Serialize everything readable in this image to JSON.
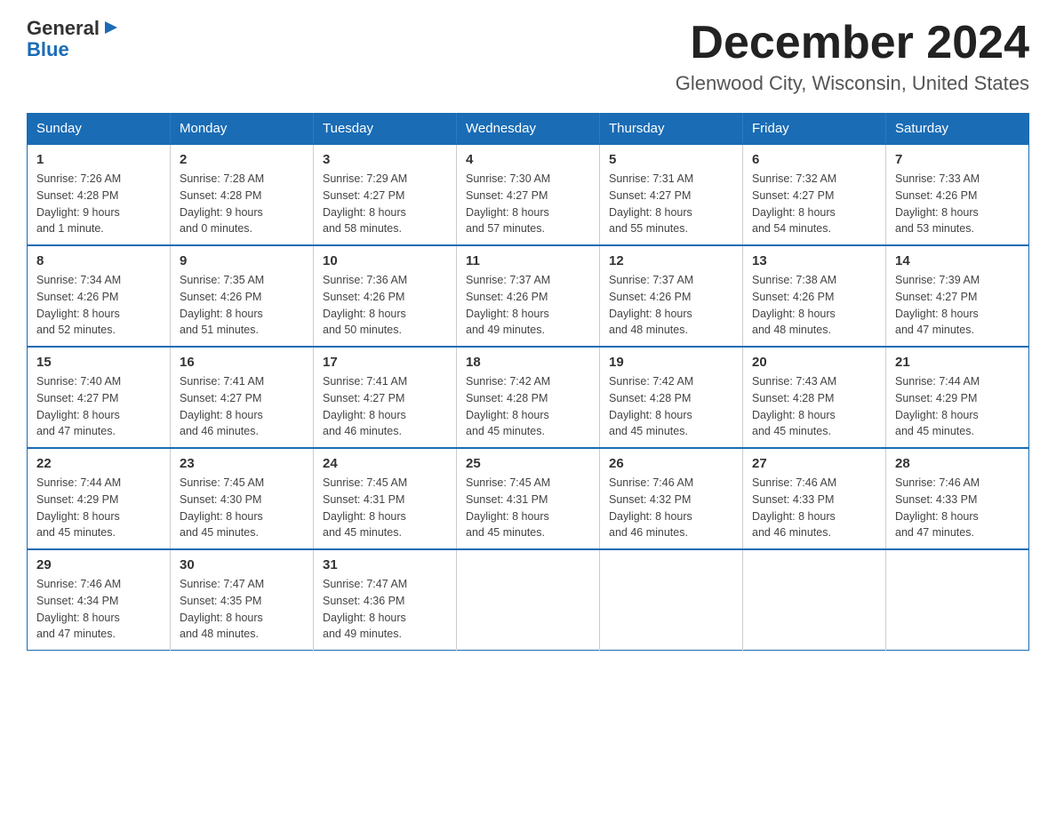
{
  "header": {
    "logo_general": "General",
    "logo_arrow": "▶",
    "logo_blue": "Blue",
    "title": "December 2024",
    "subtitle": "Glenwood City, Wisconsin, United States"
  },
  "calendar": {
    "weekdays": [
      "Sunday",
      "Monday",
      "Tuesday",
      "Wednesday",
      "Thursday",
      "Friday",
      "Saturday"
    ],
    "weeks": [
      [
        {
          "day": "1",
          "sunrise": "7:26 AM",
          "sunset": "4:28 PM",
          "daylight": "9 hours and 1 minute."
        },
        {
          "day": "2",
          "sunrise": "7:28 AM",
          "sunset": "4:28 PM",
          "daylight": "9 hours and 0 minutes."
        },
        {
          "day": "3",
          "sunrise": "7:29 AM",
          "sunset": "4:27 PM",
          "daylight": "8 hours and 58 minutes."
        },
        {
          "day": "4",
          "sunrise": "7:30 AM",
          "sunset": "4:27 PM",
          "daylight": "8 hours and 57 minutes."
        },
        {
          "day": "5",
          "sunrise": "7:31 AM",
          "sunset": "4:27 PM",
          "daylight": "8 hours and 55 minutes."
        },
        {
          "day": "6",
          "sunrise": "7:32 AM",
          "sunset": "4:27 PM",
          "daylight": "8 hours and 54 minutes."
        },
        {
          "day": "7",
          "sunrise": "7:33 AM",
          "sunset": "4:26 PM",
          "daylight": "8 hours and 53 minutes."
        }
      ],
      [
        {
          "day": "8",
          "sunrise": "7:34 AM",
          "sunset": "4:26 PM",
          "daylight": "8 hours and 52 minutes."
        },
        {
          "day": "9",
          "sunrise": "7:35 AM",
          "sunset": "4:26 PM",
          "daylight": "8 hours and 51 minutes."
        },
        {
          "day": "10",
          "sunrise": "7:36 AM",
          "sunset": "4:26 PM",
          "daylight": "8 hours and 50 minutes."
        },
        {
          "day": "11",
          "sunrise": "7:37 AM",
          "sunset": "4:26 PM",
          "daylight": "8 hours and 49 minutes."
        },
        {
          "day": "12",
          "sunrise": "7:37 AM",
          "sunset": "4:26 PM",
          "daylight": "8 hours and 48 minutes."
        },
        {
          "day": "13",
          "sunrise": "7:38 AM",
          "sunset": "4:26 PM",
          "daylight": "8 hours and 48 minutes."
        },
        {
          "day": "14",
          "sunrise": "7:39 AM",
          "sunset": "4:27 PM",
          "daylight": "8 hours and 47 minutes."
        }
      ],
      [
        {
          "day": "15",
          "sunrise": "7:40 AM",
          "sunset": "4:27 PM",
          "daylight": "8 hours and 47 minutes."
        },
        {
          "day": "16",
          "sunrise": "7:41 AM",
          "sunset": "4:27 PM",
          "daylight": "8 hours and 46 minutes."
        },
        {
          "day": "17",
          "sunrise": "7:41 AM",
          "sunset": "4:27 PM",
          "daylight": "8 hours and 46 minutes."
        },
        {
          "day": "18",
          "sunrise": "7:42 AM",
          "sunset": "4:28 PM",
          "daylight": "8 hours and 45 minutes."
        },
        {
          "day": "19",
          "sunrise": "7:42 AM",
          "sunset": "4:28 PM",
          "daylight": "8 hours and 45 minutes."
        },
        {
          "day": "20",
          "sunrise": "7:43 AM",
          "sunset": "4:28 PM",
          "daylight": "8 hours and 45 minutes."
        },
        {
          "day": "21",
          "sunrise": "7:44 AM",
          "sunset": "4:29 PM",
          "daylight": "8 hours and 45 minutes."
        }
      ],
      [
        {
          "day": "22",
          "sunrise": "7:44 AM",
          "sunset": "4:29 PM",
          "daylight": "8 hours and 45 minutes."
        },
        {
          "day": "23",
          "sunrise": "7:45 AM",
          "sunset": "4:30 PM",
          "daylight": "8 hours and 45 minutes."
        },
        {
          "day": "24",
          "sunrise": "7:45 AM",
          "sunset": "4:31 PM",
          "daylight": "8 hours and 45 minutes."
        },
        {
          "day": "25",
          "sunrise": "7:45 AM",
          "sunset": "4:31 PM",
          "daylight": "8 hours and 45 minutes."
        },
        {
          "day": "26",
          "sunrise": "7:46 AM",
          "sunset": "4:32 PM",
          "daylight": "8 hours and 46 minutes."
        },
        {
          "day": "27",
          "sunrise": "7:46 AM",
          "sunset": "4:33 PM",
          "daylight": "8 hours and 46 minutes."
        },
        {
          "day": "28",
          "sunrise": "7:46 AM",
          "sunset": "4:33 PM",
          "daylight": "8 hours and 47 minutes."
        }
      ],
      [
        {
          "day": "29",
          "sunrise": "7:46 AM",
          "sunset": "4:34 PM",
          "daylight": "8 hours and 47 minutes."
        },
        {
          "day": "30",
          "sunrise": "7:47 AM",
          "sunset": "4:35 PM",
          "daylight": "8 hours and 48 minutes."
        },
        {
          "day": "31",
          "sunrise": "7:47 AM",
          "sunset": "4:36 PM",
          "daylight": "8 hours and 49 minutes."
        },
        null,
        null,
        null,
        null
      ]
    ]
  }
}
